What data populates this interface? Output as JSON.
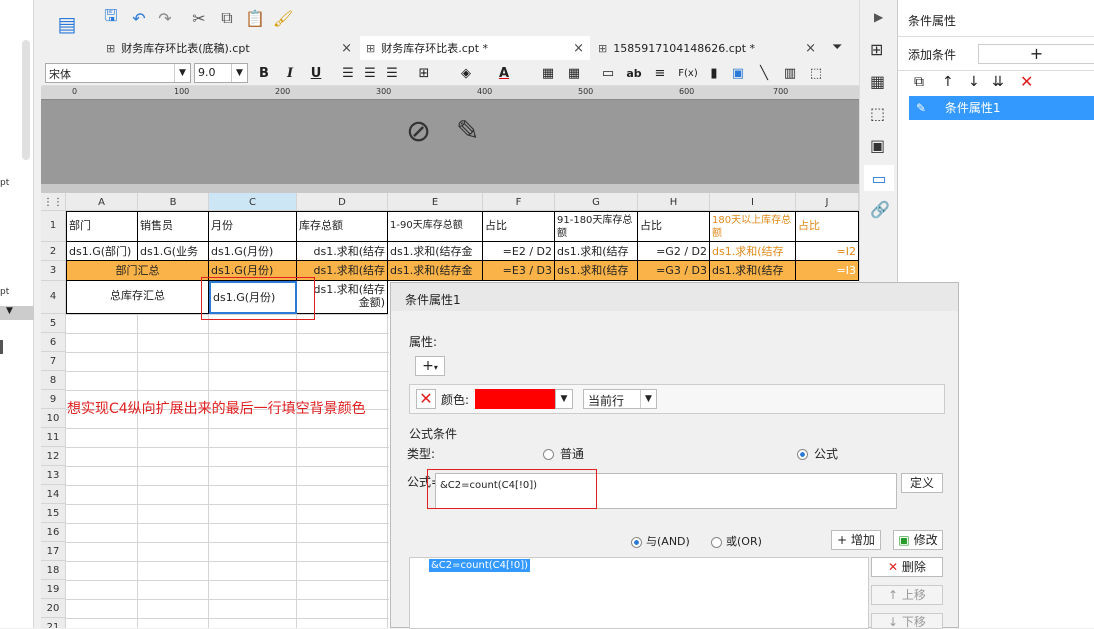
{
  "left_partial": [
    "pt",
    "pt",
    "|",
    "|"
  ],
  "toolbar": {
    "icons": [
      "template-icon",
      "save-icon",
      "undo-icon",
      "redo-icon",
      "cut-icon",
      "copy-icon",
      "paste-icon",
      "format-brush-icon"
    ]
  },
  "tabs": [
    {
      "label": "财务库存环比表(底稿).cpt",
      "close": "×"
    },
    {
      "label": "财务库存环比表.cpt *",
      "close": "×"
    },
    {
      "label": "1585917104148626.cpt *",
      "close": "×"
    }
  ],
  "format": {
    "font": "宋体",
    "size": "9.0",
    "bold": "B",
    "italic": "I",
    "underline": "U",
    "ab": "ab",
    "fx": "F(x)"
  },
  "ruler": {
    "ticks": [
      "0",
      "100",
      "200",
      "300",
      "400",
      "500",
      "600",
      "700"
    ]
  },
  "columns": [
    "A",
    "B",
    "C",
    "D",
    "E",
    "F",
    "G",
    "H",
    "I",
    "J"
  ],
  "rows": [
    "1",
    "2",
    "3",
    "4",
    "5",
    "6",
    "7",
    "8",
    "9",
    "10",
    "11",
    "12",
    "13",
    "14",
    "15",
    "16",
    "17",
    "18",
    "19",
    "20",
    "21"
  ],
  "cells": {
    "r1": [
      "部门",
      "销售员",
      "月份",
      "库存总额",
      "1-90天库存总额",
      "占比",
      "91-180天库存总额",
      "占比",
      "180天以上库存总额",
      "占比"
    ],
    "r2": [
      "ds1.G(部门)",
      "ds1.G(业务",
      "ds1.G(月份)",
      "ds1.求和(结存",
      "ds1.求和(结存金",
      "=E2 / D2",
      "ds1.求和(结存",
      "=G2 / D2",
      "ds1.求和(结存",
      "=I2"
    ],
    "r3": [
      "部门汇总",
      "ds1.G(月份)",
      "ds1.求和(结存",
      "ds1.求和(结存金",
      "=E3 / D3",
      "ds1.求和(结存",
      "=G3 / D3",
      "ds1.求和(结存",
      "=I3"
    ],
    "r4": [
      "总库存汇总",
      "ds1.G(月份)",
      "ds1.求和(结存",
      "金额)"
    ]
  },
  "annotation": "想实现C4纵向扩展出来的最后一行填空背景颜色",
  "right_panel": {
    "title": "条件属性",
    "add_label": "添加条件",
    "add_btn": "+",
    "item": "条件属性1"
  },
  "dialog": {
    "title": "条件属性1",
    "attr_label": "属性:",
    "plus": "+",
    "color_label": "颜色:",
    "scope": "当前行",
    "formula_section": "公式条件",
    "type_label": "类型:",
    "type_normal": "普通",
    "type_formula": "公式",
    "formula_label": "公式=",
    "formula_value": "&C2=count(C4[!0])",
    "define_btn": "定义",
    "and_label": "与(AND)",
    "or_label": "或(OR)",
    "add_btn": "增加",
    "edit_btn": "修改",
    "list_item": "&C2=count(C4[!0])",
    "delete_btn": "删除",
    "up_btn": "上移",
    "down_btn": "下移"
  },
  "colors": {
    "accent": "#2a7ad8",
    "condition": "#ff0000",
    "orange": "#f9b349",
    "highlight": "#3399ff"
  }
}
